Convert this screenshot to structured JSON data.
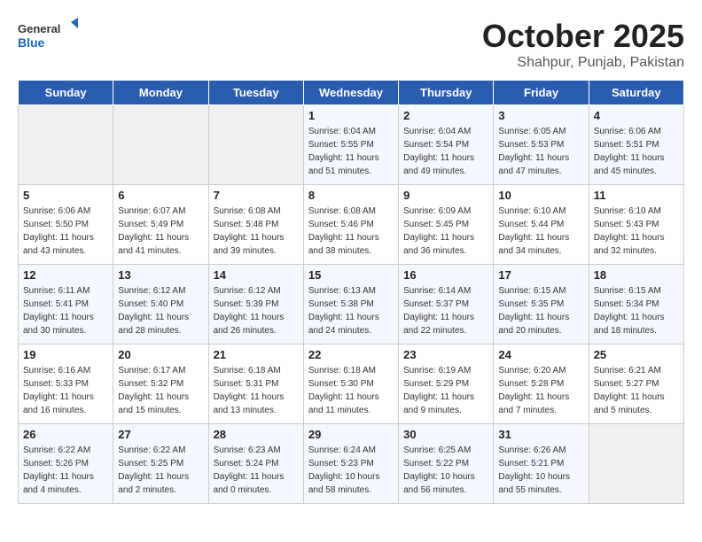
{
  "header": {
    "logo_general": "General",
    "logo_blue": "Blue",
    "month": "October 2025",
    "location": "Shahpur, Punjab, Pakistan"
  },
  "weekdays": [
    "Sunday",
    "Monday",
    "Tuesday",
    "Wednesday",
    "Thursday",
    "Friday",
    "Saturday"
  ],
  "weeks": [
    [
      {
        "day": "",
        "info": ""
      },
      {
        "day": "",
        "info": ""
      },
      {
        "day": "",
        "info": ""
      },
      {
        "day": "1",
        "info": "Sunrise: 6:04 AM\nSunset: 5:55 PM\nDaylight: 11 hours\nand 51 minutes."
      },
      {
        "day": "2",
        "info": "Sunrise: 6:04 AM\nSunset: 5:54 PM\nDaylight: 11 hours\nand 49 minutes."
      },
      {
        "day": "3",
        "info": "Sunrise: 6:05 AM\nSunset: 5:53 PM\nDaylight: 11 hours\nand 47 minutes."
      },
      {
        "day": "4",
        "info": "Sunrise: 6:06 AM\nSunset: 5:51 PM\nDaylight: 11 hours\nand 45 minutes."
      }
    ],
    [
      {
        "day": "5",
        "info": "Sunrise: 6:06 AM\nSunset: 5:50 PM\nDaylight: 11 hours\nand 43 minutes."
      },
      {
        "day": "6",
        "info": "Sunrise: 6:07 AM\nSunset: 5:49 PM\nDaylight: 11 hours\nand 41 minutes."
      },
      {
        "day": "7",
        "info": "Sunrise: 6:08 AM\nSunset: 5:48 PM\nDaylight: 11 hours\nand 39 minutes."
      },
      {
        "day": "8",
        "info": "Sunrise: 6:08 AM\nSunset: 5:46 PM\nDaylight: 11 hours\nand 38 minutes."
      },
      {
        "day": "9",
        "info": "Sunrise: 6:09 AM\nSunset: 5:45 PM\nDaylight: 11 hours\nand 36 minutes."
      },
      {
        "day": "10",
        "info": "Sunrise: 6:10 AM\nSunset: 5:44 PM\nDaylight: 11 hours\nand 34 minutes."
      },
      {
        "day": "11",
        "info": "Sunrise: 6:10 AM\nSunset: 5:43 PM\nDaylight: 11 hours\nand 32 minutes."
      }
    ],
    [
      {
        "day": "12",
        "info": "Sunrise: 6:11 AM\nSunset: 5:41 PM\nDaylight: 11 hours\nand 30 minutes."
      },
      {
        "day": "13",
        "info": "Sunrise: 6:12 AM\nSunset: 5:40 PM\nDaylight: 11 hours\nand 28 minutes."
      },
      {
        "day": "14",
        "info": "Sunrise: 6:12 AM\nSunset: 5:39 PM\nDaylight: 11 hours\nand 26 minutes."
      },
      {
        "day": "15",
        "info": "Sunrise: 6:13 AM\nSunset: 5:38 PM\nDaylight: 11 hours\nand 24 minutes."
      },
      {
        "day": "16",
        "info": "Sunrise: 6:14 AM\nSunset: 5:37 PM\nDaylight: 11 hours\nand 22 minutes."
      },
      {
        "day": "17",
        "info": "Sunrise: 6:15 AM\nSunset: 5:35 PM\nDaylight: 11 hours\nand 20 minutes."
      },
      {
        "day": "18",
        "info": "Sunrise: 6:15 AM\nSunset: 5:34 PM\nDaylight: 11 hours\nand 18 minutes."
      }
    ],
    [
      {
        "day": "19",
        "info": "Sunrise: 6:16 AM\nSunset: 5:33 PM\nDaylight: 11 hours\nand 16 minutes."
      },
      {
        "day": "20",
        "info": "Sunrise: 6:17 AM\nSunset: 5:32 PM\nDaylight: 11 hours\nand 15 minutes."
      },
      {
        "day": "21",
        "info": "Sunrise: 6:18 AM\nSunset: 5:31 PM\nDaylight: 11 hours\nand 13 minutes."
      },
      {
        "day": "22",
        "info": "Sunrise: 6:18 AM\nSunset: 5:30 PM\nDaylight: 11 hours\nand 11 minutes."
      },
      {
        "day": "23",
        "info": "Sunrise: 6:19 AM\nSunset: 5:29 PM\nDaylight: 11 hours\nand 9 minutes."
      },
      {
        "day": "24",
        "info": "Sunrise: 6:20 AM\nSunset: 5:28 PM\nDaylight: 11 hours\nand 7 minutes."
      },
      {
        "day": "25",
        "info": "Sunrise: 6:21 AM\nSunset: 5:27 PM\nDaylight: 11 hours\nand 5 minutes."
      }
    ],
    [
      {
        "day": "26",
        "info": "Sunrise: 6:22 AM\nSunset: 5:26 PM\nDaylight: 11 hours\nand 4 minutes."
      },
      {
        "day": "27",
        "info": "Sunrise: 6:22 AM\nSunset: 5:25 PM\nDaylight: 11 hours\nand 2 minutes."
      },
      {
        "day": "28",
        "info": "Sunrise: 6:23 AM\nSunset: 5:24 PM\nDaylight: 11 hours\nand 0 minutes."
      },
      {
        "day": "29",
        "info": "Sunrise: 6:24 AM\nSunset: 5:23 PM\nDaylight: 10 hours\nand 58 minutes."
      },
      {
        "day": "30",
        "info": "Sunrise: 6:25 AM\nSunset: 5:22 PM\nDaylight: 10 hours\nand 56 minutes."
      },
      {
        "day": "31",
        "info": "Sunrise: 6:26 AM\nSunset: 5:21 PM\nDaylight: 10 hours\nand 55 minutes."
      },
      {
        "day": "",
        "info": ""
      }
    ]
  ]
}
